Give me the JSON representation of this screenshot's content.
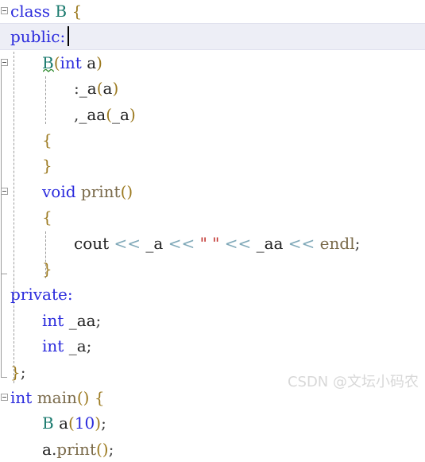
{
  "editor": {
    "language": "C++",
    "font_size_px": 20,
    "line_height_px": 32.4,
    "background_color": "#ffffff",
    "current_line_highlight_color": "#edeef6",
    "current_line_index": 1,
    "caret_after_text": "public:",
    "colors": {
      "keyword": "#2b2bdd",
      "class_name": "#1a7a6e",
      "brace": "#9c7a20",
      "function": "#7a6a4a",
      "identifier": "#222222",
      "stream_operator": "#7fa8b8",
      "string": "#c0302b",
      "number": "#2b2bdd",
      "squiggle_warning": "#2e8b2e",
      "indent_guide": "#9d9d9d",
      "fold_marker": "#a0a0a0"
    },
    "lines": [
      {
        "indent": 0,
        "tokens": [
          {
            "t": "class",
            "c": "kw"
          },
          {
            "t": " ",
            "c": "id"
          },
          {
            "t": "B",
            "c": "type"
          },
          {
            "t": " ",
            "c": "id"
          },
          {
            "t": "{",
            "c": "brace"
          }
        ]
      },
      {
        "indent": 0,
        "tokens": [
          {
            "t": "public",
            "c": "kw"
          },
          {
            "t": ":",
            "c": "kw"
          }
        ]
      },
      {
        "indent": 2,
        "tokens": [
          {
            "t": "B",
            "c": "type"
          },
          {
            "t": "(",
            "c": "brace"
          },
          {
            "t": "int",
            "c": "kw"
          },
          {
            "t": " ",
            "c": "id"
          },
          {
            "t": "a",
            "c": "id"
          },
          {
            "t": ")",
            "c": "brace"
          }
        ]
      },
      {
        "indent": 4,
        "tokens": [
          {
            "t": ":",
            "c": "punct"
          },
          {
            "t": "_a",
            "c": "id"
          },
          {
            "t": "(",
            "c": "brace"
          },
          {
            "t": "a",
            "c": "id"
          },
          {
            "t": ")",
            "c": "brace"
          }
        ]
      },
      {
        "indent": 4,
        "tokens": [
          {
            "t": ",",
            "c": "punct"
          },
          {
            "t": "_aa",
            "c": "id"
          },
          {
            "t": "(",
            "c": "brace"
          },
          {
            "t": "_a",
            "c": "id"
          },
          {
            "t": ")",
            "c": "brace"
          }
        ]
      },
      {
        "indent": 2,
        "tokens": [
          {
            "t": "{",
            "c": "brace"
          }
        ]
      },
      {
        "indent": 2,
        "tokens": [
          {
            "t": "}",
            "c": "brace"
          }
        ]
      },
      {
        "indent": 2,
        "tokens": [
          {
            "t": "void",
            "c": "kw"
          },
          {
            "t": " ",
            "c": "id"
          },
          {
            "t": "print",
            "c": "fn"
          },
          {
            "t": "()",
            "c": "brace"
          }
        ]
      },
      {
        "indent": 2,
        "tokens": [
          {
            "t": "{",
            "c": "brace"
          }
        ]
      },
      {
        "indent": 4,
        "tokens": [
          {
            "t": "cout",
            "c": "id"
          },
          {
            "t": " ",
            "c": "id"
          },
          {
            "t": "<<",
            "c": "op"
          },
          {
            "t": " ",
            "c": "id"
          },
          {
            "t": "_a",
            "c": "id"
          },
          {
            "t": " ",
            "c": "id"
          },
          {
            "t": "<<",
            "c": "op"
          },
          {
            "t": " ",
            "c": "id"
          },
          {
            "t": "\" \"",
            "c": "str"
          },
          {
            "t": " ",
            "c": "id"
          },
          {
            "t": "<<",
            "c": "op"
          },
          {
            "t": " ",
            "c": "id"
          },
          {
            "t": "_aa",
            "c": "id"
          },
          {
            "t": " ",
            "c": "id"
          },
          {
            "t": "<<",
            "c": "op"
          },
          {
            "t": " ",
            "c": "id"
          },
          {
            "t": "endl",
            "c": "fn"
          },
          {
            "t": ";",
            "c": "punct"
          }
        ]
      },
      {
        "indent": 2,
        "tokens": [
          {
            "t": "}",
            "c": "brace"
          }
        ]
      },
      {
        "indent": 0,
        "tokens": [
          {
            "t": "private",
            "c": "kw"
          },
          {
            "t": ":",
            "c": "kw"
          }
        ]
      },
      {
        "indent": 2,
        "tokens": [
          {
            "t": "int",
            "c": "kw"
          },
          {
            "t": " ",
            "c": "id"
          },
          {
            "t": "_aa",
            "c": "id"
          },
          {
            "t": ";",
            "c": "punct"
          }
        ]
      },
      {
        "indent": 2,
        "tokens": [
          {
            "t": "int",
            "c": "kw"
          },
          {
            "t": " ",
            "c": "id"
          },
          {
            "t": "_a",
            "c": "id"
          },
          {
            "t": ";",
            "c": "punct"
          }
        ]
      },
      {
        "indent": 0,
        "tokens": [
          {
            "t": "}",
            "c": "brace"
          },
          {
            "t": ";",
            "c": "punct"
          }
        ]
      },
      {
        "indent": 0,
        "tokens": [
          {
            "t": "int",
            "c": "kw"
          },
          {
            "t": " ",
            "c": "id"
          },
          {
            "t": "main",
            "c": "fn"
          },
          {
            "t": "()",
            "c": "brace"
          },
          {
            "t": " ",
            "c": "id"
          },
          {
            "t": "{",
            "c": "brace"
          }
        ]
      },
      {
        "indent": 2,
        "tokens": [
          {
            "t": "B",
            "c": "type"
          },
          {
            "t": " ",
            "c": "id"
          },
          {
            "t": "a",
            "c": "id"
          },
          {
            "t": "(",
            "c": "brace"
          },
          {
            "t": "10",
            "c": "num"
          },
          {
            "t": ")",
            "c": "brace"
          },
          {
            "t": ";",
            "c": "punct"
          }
        ]
      },
      {
        "indent": 2,
        "tokens": [
          {
            "t": "a",
            "c": "id"
          },
          {
            "t": ".",
            "c": "punct"
          },
          {
            "t": "print",
            "c": "fn"
          },
          {
            "t": "()",
            "c": "brace"
          },
          {
            "t": ";",
            "c": "punct"
          }
        ]
      }
    ],
    "plain_text_lines": [
      "class B {",
      "public:",
      "    B(int a)",
      "        :_a(a)",
      "        ,_aa(_a)",
      "    {",
      "    }",
      "    void print()",
      "    {",
      "        cout << _a << \" \" << _aa << endl;",
      "    }",
      "private:",
      "    int _aa;",
      "    int _a;",
      "};",
      "int main() {",
      "    B a(10);",
      "    a.print();"
    ],
    "fold_markers": [
      {
        "line": 0,
        "state": "expanded"
      },
      {
        "line": 2,
        "state": "expanded"
      },
      {
        "line": 7,
        "state": "expanded"
      },
      {
        "line": 15,
        "state": "expanded"
      }
    ],
    "fold_end_lines": [
      10,
      14
    ],
    "warning_squiggle": {
      "line": 2,
      "token": "B",
      "color": "#2e8b2e"
    }
  },
  "watermark": {
    "text": "CSDN @文坛小码农"
  }
}
